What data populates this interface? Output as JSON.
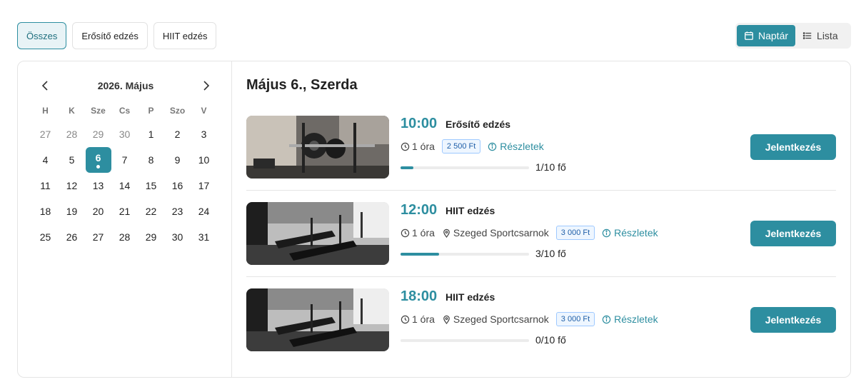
{
  "filters": [
    {
      "label": "Összes",
      "active": true
    },
    {
      "label": "Erősítő edzés",
      "active": false
    },
    {
      "label": "HIIT edzés",
      "active": false
    }
  ],
  "view_toggle": {
    "calendar_label": "Naptár",
    "list_label": "Lista",
    "active": "calendar"
  },
  "calendar": {
    "title": "2026. Május",
    "weekdays": [
      "H",
      "K",
      "Sze",
      "Cs",
      "P",
      "Szo",
      "V"
    ],
    "days": [
      {
        "n": "27",
        "muted": true
      },
      {
        "n": "28",
        "muted": true
      },
      {
        "n": "29",
        "muted": true
      },
      {
        "n": "30",
        "muted": true
      },
      {
        "n": "1"
      },
      {
        "n": "2"
      },
      {
        "n": "3"
      },
      {
        "n": "4"
      },
      {
        "n": "5"
      },
      {
        "n": "6",
        "selected": true
      },
      {
        "n": "7"
      },
      {
        "n": "8"
      },
      {
        "n": "9"
      },
      {
        "n": "10"
      },
      {
        "n": "11"
      },
      {
        "n": "12"
      },
      {
        "n": "13"
      },
      {
        "n": "14"
      },
      {
        "n": "15"
      },
      {
        "n": "16"
      },
      {
        "n": "17"
      },
      {
        "n": "18"
      },
      {
        "n": "19"
      },
      {
        "n": "20"
      },
      {
        "n": "21"
      },
      {
        "n": "22"
      },
      {
        "n": "23"
      },
      {
        "n": "24"
      },
      {
        "n": "25"
      },
      {
        "n": "26"
      },
      {
        "n": "27"
      },
      {
        "n": "28"
      },
      {
        "n": "29"
      },
      {
        "n": "30"
      },
      {
        "n": "31"
      }
    ]
  },
  "events_panel": {
    "day_title": "Május 6., Szerda",
    "events": [
      {
        "time": "10:00",
        "name": "Erősítő edzés",
        "duration": "1 óra",
        "location": "",
        "price": "2 500 Ft",
        "details_label": "Részletek",
        "capacity": "1/10 fő",
        "fill_fraction": 0.1,
        "apply_label": "Jelentkezés",
        "image": "gym-weights"
      },
      {
        "time": "12:00",
        "name": "HIIT edzés",
        "duration": "1 óra",
        "location": "Szeged Sportcsarnok",
        "price": "3 000 Ft",
        "details_label": "Részletek",
        "capacity": "3/10 fő",
        "fill_fraction": 0.3,
        "apply_label": "Jelentkezés",
        "image": "gym-treadmills"
      },
      {
        "time": "18:00",
        "name": "HIIT edzés",
        "duration": "1 óra",
        "location": "Szeged Sportcsarnok",
        "price": "3 000 Ft",
        "details_label": "Részletek",
        "capacity": "0/10 fő",
        "fill_fraction": 0.0,
        "apply_label": "Jelentkezés",
        "image": "gym-treadmills"
      }
    ]
  },
  "colors": {
    "accent": "#2d8ea0",
    "price_bg": "#eef6ff",
    "price_border": "#9ec9ff"
  }
}
